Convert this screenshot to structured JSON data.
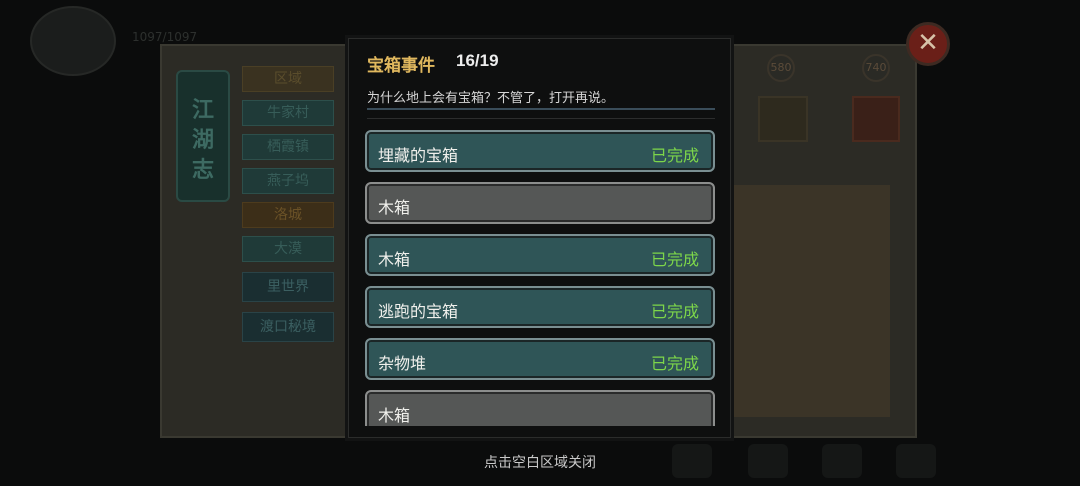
{
  "background": {
    "hp_text": "1097/1097",
    "region_header": "区域",
    "regions": [
      "牛家村",
      "栖霞镇",
      "燕子坞",
      "洛城",
      "大漠"
    ],
    "inner_world": "里世界",
    "ferry_realm": "渡口秘境",
    "book_title_chars": [
      "江",
      "湖",
      "志"
    ],
    "stat_values": [
      "580",
      "740"
    ]
  },
  "modal": {
    "title": "宝箱事件",
    "count": "16/19",
    "description": "为什么地上会有宝箱？不管了，打开再说。",
    "items": [
      {
        "name": "埋藏的宝箱",
        "status": "已完成",
        "done": true
      },
      {
        "name": "木箱",
        "status": "",
        "done": false
      },
      {
        "name": "木箱",
        "status": "已完成",
        "done": true
      },
      {
        "name": "逃跑的宝箱",
        "status": "已完成",
        "done": true
      },
      {
        "name": "杂物堆",
        "status": "已完成",
        "done": true
      },
      {
        "name": "木箱",
        "status": "",
        "done": false
      }
    ]
  },
  "close_icon": "close-x-icon",
  "footer": {
    "hint": "点击空白区域关闭"
  },
  "colors": {
    "title_gold": "#e0b85e",
    "done_green": "#7dd64a",
    "row_done_bg": "#2f5557",
    "row_todo_bg": "#555756"
  }
}
